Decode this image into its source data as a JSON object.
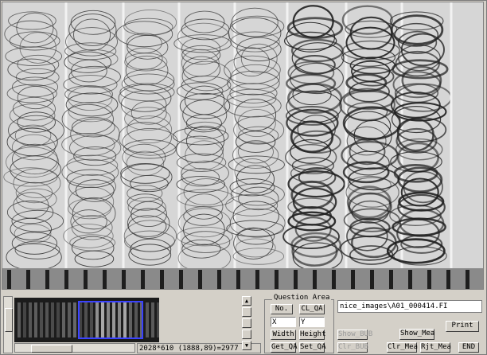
{
  "question_area": {
    "title": "Question Area",
    "no_label": "No.",
    "clear_qa_label": "CL_QA",
    "x_label": "X",
    "y_label": "Y",
    "width_label": "Width",
    "height_label": "Height",
    "get_qa_label": "Get_QA",
    "set_qa_label": "Set_QA"
  },
  "file_path": "nice_images\\A01_000414.FI",
  "buttons": {
    "show_bub": "Show_BUB",
    "show_mea": "Show_Mea",
    "print": "Print",
    "clr_bub": "Clr_BUB",
    "clr_mea": "Clr_Mea",
    "rjt_mea": "Rjt_Mea",
    "end": "END"
  },
  "status": {
    "image_size": "2028*610",
    "coords": "(1888,89)=2977"
  }
}
